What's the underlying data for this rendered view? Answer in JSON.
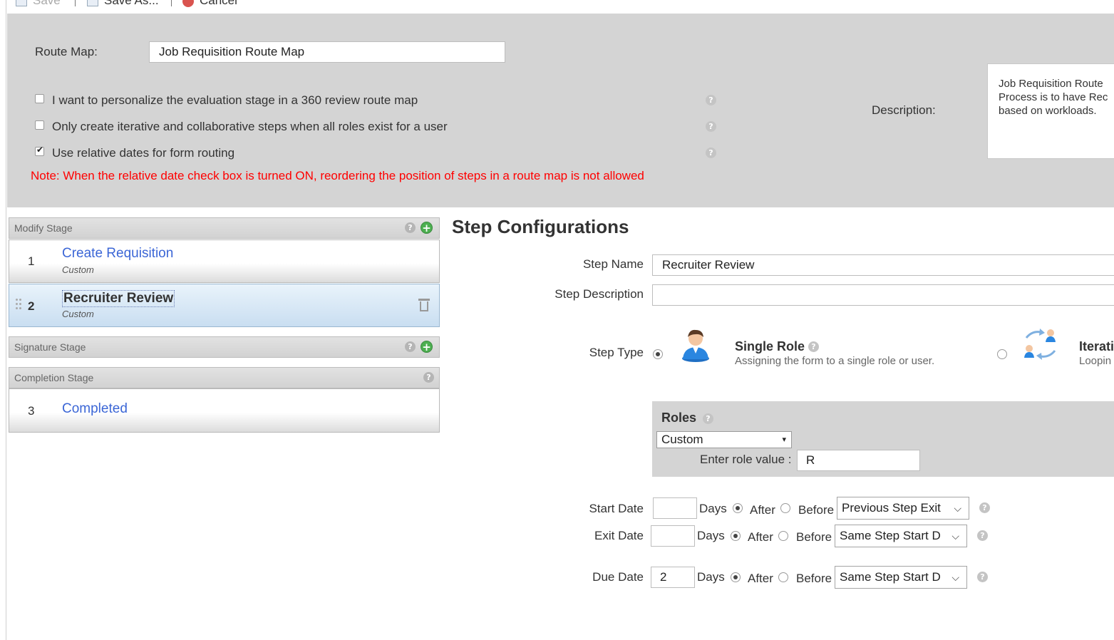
{
  "toolbar": {
    "save_label": "Save",
    "save_as_label": "Save As...",
    "cancel_label": "Cancel"
  },
  "route_map": {
    "label": "Route Map:",
    "value": "Job Requisition Route Map",
    "description_label": "Description:",
    "description_lines": [
      "Job Requisition Route",
      "Process is to have Rec",
      "based on workloads."
    ]
  },
  "options": [
    {
      "label": "I want to personalize the evaluation stage in a 360 review route map",
      "checked": false
    },
    {
      "label": "Only create iterative and collaborative steps when all roles exist for a user",
      "checked": false
    },
    {
      "label": "Use relative dates for form routing",
      "checked": true
    }
  ],
  "note": "Note: When the relative date check box is turned ON, reordering the position of steps in a route map is not allowed",
  "stages": {
    "modify": {
      "title": "Modify Stage",
      "steps": [
        {
          "num": "1",
          "name": "Create Requisition",
          "sub": "Custom"
        },
        {
          "num": "2",
          "name": "Recruiter Review",
          "sub": "Custom"
        }
      ]
    },
    "signature": {
      "title": "Signature Stage"
    },
    "completion": {
      "title": "Completion Stage",
      "steps": [
        {
          "num": "3",
          "name": "Completed"
        }
      ]
    }
  },
  "config": {
    "title": "Step Configurations",
    "step_name_label": "Step Name",
    "step_name_value": "Recruiter Review",
    "step_description_label": "Step Description",
    "step_description_value": "",
    "step_type_label": "Step Type",
    "single_role_title": "Single Role",
    "single_role_desc": "Assigning the form to a single role or user.",
    "iterative_title": "Iterati",
    "iterative_desc": "Loopin",
    "roles_title": "Roles",
    "roles_select": "Custom",
    "role_value_label": "Enter role value :",
    "role_value": "R",
    "start_date_label": "Start Date",
    "exit_date_label": "Exit Date",
    "due_date_label": "Due Date",
    "days_label": "Days",
    "after_label": "After",
    "before_label": "Before",
    "start_days": "",
    "exit_days": "",
    "due_days": "2",
    "start_ref": "Previous Step Exit",
    "exit_ref": "Same Step Start D",
    "due_ref": "Same Step Start D"
  },
  "icons": {
    "help": "?",
    "add": "+",
    "select_arrow": "▾",
    "chevron": "⌵"
  }
}
